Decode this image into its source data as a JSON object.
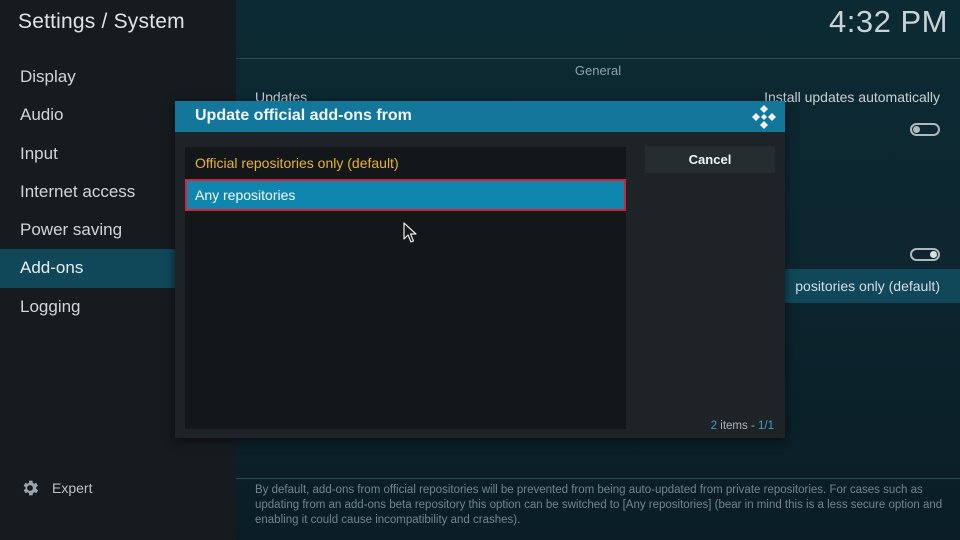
{
  "header": {
    "title": "Settings / System",
    "clock": "4:32 PM"
  },
  "sidebar": {
    "items": [
      {
        "label": "Display"
      },
      {
        "label": "Audio"
      },
      {
        "label": "Input"
      },
      {
        "label": "Internet access"
      },
      {
        "label": "Power saving"
      },
      {
        "label": "Add-ons",
        "active": true
      },
      {
        "label": "Logging"
      }
    ],
    "expert_label": "Expert"
  },
  "settings": {
    "section_label": "General",
    "updates_label": "Updates",
    "updates_value": "Install updates automatically",
    "highlighted_value": "positories only (default)"
  },
  "description": "By default, add-ons from official repositories will be prevented from being auto-updated from private repositories. For cases such as updating from an add-ons beta repository this option can be switched to [Any repositories] (bear in mind this is a less secure option and enabling it could cause incompatibility and crashes).",
  "dialog": {
    "title": "Update official add-ons from",
    "options": [
      {
        "label": "Official repositories only (default)",
        "state": "selected"
      },
      {
        "label": "Any repositories",
        "state": "focused"
      }
    ],
    "cancel_label": "Cancel",
    "count_num": "2",
    "count_word": "items",
    "count_sep": "-",
    "count_page": "1/1"
  },
  "colors": {
    "accent": "#12779a",
    "focus": "#0f86ad",
    "selected_text": "#e8b233",
    "focus_border": "#d0243a"
  }
}
